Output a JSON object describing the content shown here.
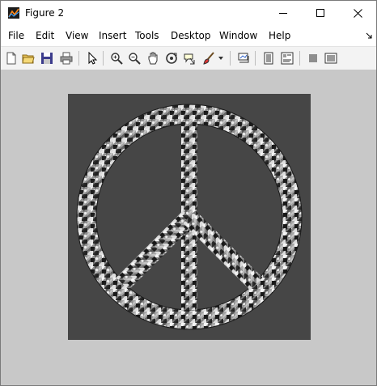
{
  "window": {
    "title": "Figure 2",
    "controls": [
      "minimize",
      "maximize",
      "close"
    ]
  },
  "menu": [
    {
      "label": "File"
    },
    {
      "label": "Edit"
    },
    {
      "label": "View"
    },
    {
      "label": "Insert"
    },
    {
      "label": "Tools"
    },
    {
      "label": "Desktop"
    },
    {
      "label": "Window"
    },
    {
      "label": "Help"
    }
  ],
  "toolbar": {
    "buttons": [
      "new-figure-icon",
      "open-file-icon",
      "save-icon",
      "print-icon",
      "edit-plot-pointer-icon",
      "zoom-in-icon",
      "zoom-out-icon",
      "pan-hand-icon",
      "rotate-3d-icon",
      "data-cursor-icon",
      "brush-icon",
      "link-plot-icon",
      "hide-plot-tools-icon",
      "show-plot-tools-icon",
      "plot-browser-icon",
      "property-editor-icon"
    ]
  },
  "figure": {
    "background": "#c8c8c8",
    "axes_background": "#464646",
    "image_subject": "peace symbol mosaic made of grayscale flags"
  }
}
